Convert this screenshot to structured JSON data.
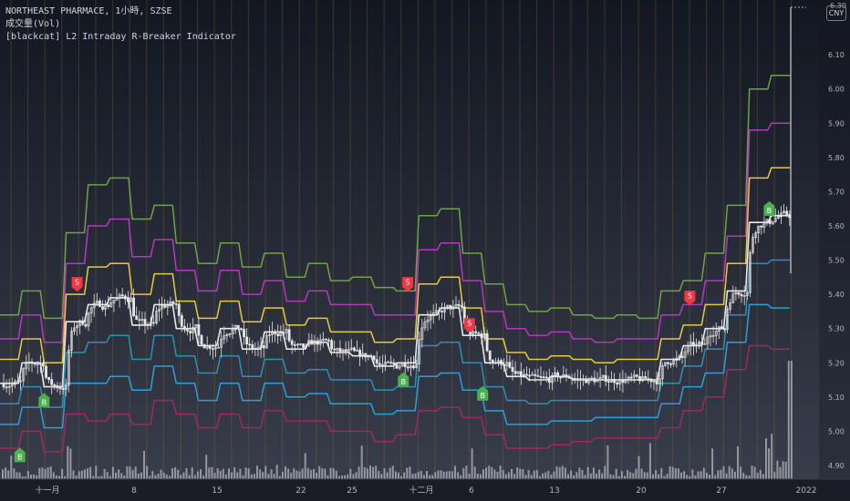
{
  "header": {
    "symbol_line": "NORTHEAST PHARMACE, 1小時, SZSE",
    "volume_line": "成交量(Vol)",
    "indicator_line": "[blackcat] L2 Intraday R-Breaker Indicator",
    "currency": "CNY",
    "price_top": "6.30"
  },
  "colors": {
    "background_top": "#131722",
    "background_bottom": "#3b3f4d",
    "vertical_lines": "#8a6d2a",
    "candle": "#e6e6e6",
    "volume": "#b2b5be",
    "sell_label": "#f23645",
    "buy_label": "#4caf50"
  },
  "chart_data": {
    "type": "line",
    "title": "",
    "x_ticks": [
      "十一月",
      "8",
      "15",
      "22",
      "25",
      "十二月",
      "6",
      "13",
      "20",
      "27",
      "2022"
    ],
    "y_ticks": [
      4.9,
      5.0,
      5.1,
      5.2,
      5.3,
      5.4,
      5.5,
      5.6,
      5.7,
      5.8,
      5.9,
      6.0,
      6.1
    ],
    "ylim": [
      4.86,
      6.26
    ],
    "grid": false,
    "series": [
      {
        "name": "",
        "color": "#6da344",
        "values": [
          5.34,
          5.41,
          5.33,
          5.58,
          5.72,
          5.74,
          5.62,
          5.66,
          5.55,
          5.49,
          5.55,
          5.48,
          5.52,
          5.45,
          5.49,
          5.44,
          5.45,
          5.42,
          5.41,
          5.63,
          5.65,
          5.52,
          5.43,
          5.37,
          5.35,
          5.36,
          5.34,
          5.33,
          5.34,
          5.33,
          5.41,
          5.44,
          5.52,
          5.66,
          6.0,
          6.04
        ]
      },
      {
        "name": "",
        "color": "#b637bf",
        "values": [
          5.27,
          5.34,
          5.26,
          5.49,
          5.6,
          5.62,
          5.51,
          5.56,
          5.47,
          5.41,
          5.47,
          5.4,
          5.44,
          5.38,
          5.41,
          5.37,
          5.37,
          5.34,
          5.34,
          5.53,
          5.55,
          5.44,
          5.35,
          5.3,
          5.28,
          5.29,
          5.27,
          5.26,
          5.27,
          5.27,
          5.34,
          5.37,
          5.44,
          5.57,
          5.88,
          5.9
        ]
      },
      {
        "name": "",
        "color": "#e6c93e",
        "values": [
          5.21,
          5.27,
          5.2,
          5.4,
          5.48,
          5.49,
          5.4,
          5.46,
          5.38,
          5.33,
          5.38,
          5.32,
          5.36,
          5.31,
          5.33,
          5.29,
          5.29,
          5.26,
          5.27,
          5.43,
          5.45,
          5.36,
          5.27,
          5.23,
          5.21,
          5.22,
          5.21,
          5.2,
          5.21,
          5.21,
          5.27,
          5.31,
          5.37,
          5.49,
          5.74,
          5.77
        ]
      },
      {
        "name": "",
        "color": "#e8e8e8",
        "values": [
          5.14,
          5.2,
          5.13,
          5.32,
          5.37,
          5.39,
          5.31,
          5.37,
          5.3,
          5.25,
          5.3,
          5.24,
          5.29,
          5.24,
          5.26,
          5.23,
          5.22,
          5.19,
          5.2,
          5.34,
          5.36,
          5.28,
          5.2,
          5.16,
          5.15,
          5.16,
          5.15,
          5.15,
          5.15,
          5.15,
          5.21,
          5.25,
          5.3,
          5.41,
          5.61,
          5.63
        ]
      },
      {
        "name": "",
        "color": "#2f8fb3",
        "values": [
          5.08,
          5.13,
          5.07,
          5.23,
          5.26,
          5.28,
          5.21,
          5.28,
          5.22,
          5.17,
          5.22,
          5.16,
          5.21,
          5.17,
          5.18,
          5.15,
          5.15,
          5.12,
          5.13,
          5.25,
          5.26,
          5.2,
          5.13,
          5.09,
          5.08,
          5.09,
          5.09,
          5.09,
          5.09,
          5.09,
          5.14,
          5.19,
          5.24,
          5.34,
          5.49,
          5.5
        ]
      },
      {
        "name": "",
        "color": "#2b9fd6",
        "values": [
          5.02,
          5.07,
          5.01,
          5.14,
          5.14,
          5.16,
          5.12,
          5.19,
          5.14,
          5.09,
          5.14,
          5.09,
          5.14,
          5.1,
          5.11,
          5.08,
          5.08,
          5.05,
          5.06,
          5.16,
          5.17,
          5.12,
          5.06,
          5.02,
          5.02,
          5.03,
          5.03,
          5.04,
          5.04,
          5.04,
          5.08,
          5.13,
          5.17,
          5.26,
          5.37,
          5.36
        ]
      },
      {
        "name": "",
        "color": "#9e2960",
        "values": [
          4.95,
          5.0,
          4.94,
          5.05,
          5.03,
          5.05,
          5.02,
          5.09,
          5.05,
          5.01,
          5.05,
          5.01,
          5.06,
          5.03,
          5.03,
          5.0,
          5.0,
          4.97,
          4.99,
          5.06,
          5.07,
          5.04,
          4.99,
          4.95,
          4.95,
          4.96,
          4.97,
          4.98,
          4.98,
          4.98,
          5.01,
          5.06,
          5.1,
          5.18,
          5.25,
          5.24
        ]
      }
    ],
    "signals": [
      {
        "type": "sell",
        "text": "S",
        "bar": 3,
        "price": 5.4
      },
      {
        "type": "sell",
        "text": "S",
        "bar": 18,
        "price": 5.4
      },
      {
        "type": "sell",
        "text": "S",
        "bar": 20.8,
        "price": 5.28
      },
      {
        "type": "sell",
        "text": "S",
        "bar": 30.8,
        "price": 5.36
      },
      {
        "type": "buy",
        "text": "B",
        "bar": 0.4,
        "price": 4.96
      },
      {
        "type": "buy",
        "text": "B",
        "bar": 1.5,
        "price": 5.12
      },
      {
        "type": "buy",
        "text": "B",
        "bar": 17.8,
        "price": 5.18
      },
      {
        "type": "buy",
        "text": "B",
        "bar": 21.4,
        "price": 5.14
      },
      {
        "type": "buy",
        "text": "B",
        "bar": 34.4,
        "price": 5.68
      }
    ]
  }
}
